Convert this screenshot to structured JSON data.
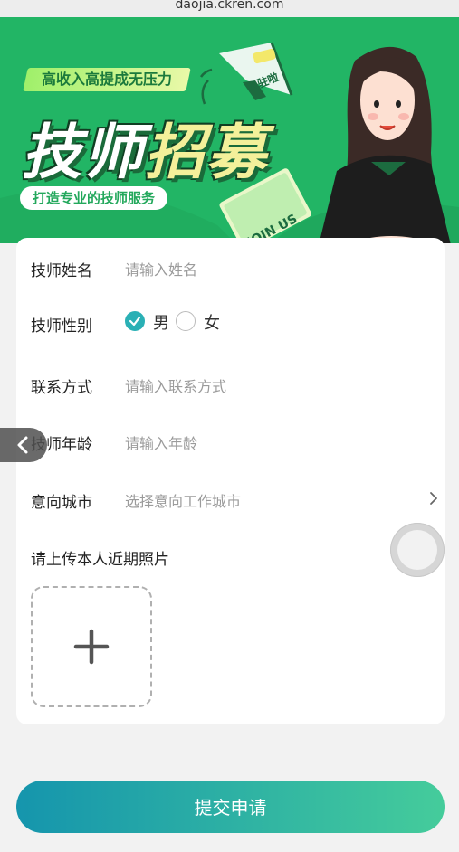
{
  "browser": {
    "url": "daojia.ckren.com"
  },
  "banner": {
    "slogan": "高收入高提成无压力",
    "title_part1": "技师",
    "title_part2": "招募",
    "subtitle": "打造专业的技师服务",
    "megaphone_text": "入驻啦",
    "card_text": "JOIN US",
    "colors": {
      "background": "#22b565",
      "accent": "#f4f09a"
    }
  },
  "form": {
    "name": {
      "label": "技师姓名",
      "placeholder": "请输入姓名"
    },
    "gender": {
      "label": "技师性别",
      "options": [
        "男",
        "女"
      ],
      "selected": "男"
    },
    "contact": {
      "label": "联系方式",
      "placeholder": "请输入联系方式"
    },
    "age": {
      "label": "技师年龄",
      "placeholder": "请输入年龄"
    },
    "city": {
      "label": "意向城市",
      "placeholder": "选择意向工作城市"
    },
    "photo": {
      "label": "请上传本人近期照片"
    }
  },
  "submit": {
    "label": "提交申请"
  },
  "icons": {
    "back": "chevron-left-icon",
    "city_arrow": "chevron-right-icon",
    "upload": "plus-icon",
    "radio_checked": "checkmark-icon",
    "floating": "assistive-touch-icon"
  },
  "colors": {
    "primary": "#2ab0b5",
    "submit_start": "#1595ad",
    "submit_end": "#45cc9b"
  }
}
